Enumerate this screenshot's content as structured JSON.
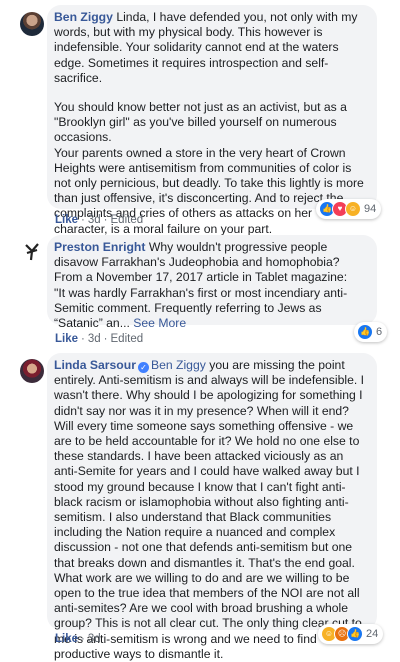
{
  "comments": [
    {
      "author": "Ben Ziggy",
      "paragraphs": [
        "Linda, I have defended you, not only with my words, but with my physical body. This however is indefensible. Your solidarity cannot end at the waters edge. Sometimes it requires introspection and self-sacrifice.",
        "You should know better not just as an activist, but as a \"Brooklyn girl\" as you've billed yourself on numerous occasions.\nYour parents owned a store in the very heart of Crown Heights were antisemitism from communities of color is not only pernicious, but deadly. To take this lightly is more than just offensive, it's disconcerting. And to reject the complaints and cries of others as attacks on her character, is a moral failure on your part."
      ],
      "actions": {
        "like": "Like",
        "time": "3d",
        "edited": "Edited"
      },
      "reactions": {
        "count": "94",
        "icons": [
          "like-icon",
          "love-icon",
          "haha-icon"
        ]
      }
    },
    {
      "author": "Preston Enright",
      "text": "Why wouldn't progressive people disavow Farrakhan's Judeophobia and homophobia?\nFrom a November 17, 2017 article in Tablet magazine:\n\"It was hardly Farrakhan's first or most incendiary anti-Semitic comment. Frequently referring to Jews as “Satanic” an...",
      "see_more": "See More",
      "actions": {
        "like": "Like",
        "time": "3d",
        "edited": "Edited"
      },
      "reactions": {
        "count": "6",
        "icons": [
          "like-icon"
        ]
      }
    },
    {
      "author": "Linda Sarsour",
      "mention": "Ben Ziggy",
      "text": "you are missing the point entirely. Anti-semitism is and always will be indefensible. I wasn't there. Why should I be apologizing for something I didn't say nor was it in my presence? When will it end? Will every time someone says something offensive - we are to be held accountable for it? We hold no one else to these standards. I have been attacked viciously as an anti-Semite for years and I could have walked away but I stood my ground because I know that I can't fight anti-black racism or islamophobia without also fighting anti-semitism. I also understand that Black communities including the Nation require a nuanced and complex discussion - not one that defends anti-semitism but one that breaks down and dismantles it. That's the end goal. What work are we willing to do and are we willing to be open to the true idea that members of the NOI are not all anti-semites? Are we cool with broad brushing a whole group? This is not all clear cut. The only thing clear cut to me is anti-semitism is wrong and we need to find productive ways to dismantle it.",
      "actions": {
        "like": "Like",
        "time": "3d"
      },
      "reactions": {
        "count": "24",
        "icons": [
          "haha-icon",
          "angry-icon",
          "like-icon"
        ]
      }
    }
  ],
  "colors": {
    "link": "#385898",
    "bubble": "#f2f3f5",
    "meta": "#606770"
  }
}
